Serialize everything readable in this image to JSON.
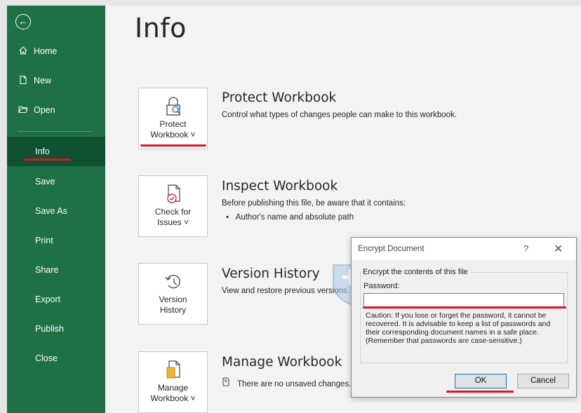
{
  "sidebar": {
    "back_icon": "back-arrow-circle-icon",
    "items": [
      {
        "label": "Home",
        "icon": "home-icon"
      },
      {
        "label": "New",
        "icon": "new-file-icon"
      },
      {
        "label": "Open",
        "icon": "folder-open-icon"
      },
      {
        "label": "Info",
        "selected": true
      },
      {
        "label": "Save"
      },
      {
        "label": "Save As"
      },
      {
        "label": "Print"
      },
      {
        "label": "Share"
      },
      {
        "label": "Export"
      },
      {
        "label": "Publish"
      },
      {
        "label": "Close"
      }
    ],
    "color": "#1e7145",
    "selected_color": "#0f5132"
  },
  "main": {
    "title": "Info",
    "sections": [
      {
        "button_line1": "Protect",
        "button_line2": "Workbook ˅",
        "icon": "lock-magnifier-icon",
        "title": "Protect Workbook",
        "description": "Control what types of changes people can make to this workbook."
      },
      {
        "button_line1": "Check for",
        "button_line2": "Issues ˅",
        "icon": "document-check-icon",
        "title": "Inspect Workbook",
        "description": "Before publishing this file, be aware that it contains:",
        "bullets": [
          "Author's name and absolute path"
        ]
      },
      {
        "button_line1": "Version",
        "button_line2": "History",
        "icon": "history-clock-icon",
        "title": "Version History",
        "description": "View and restore previous versions."
      },
      {
        "button_line1": "Manage",
        "button_line2": "Workbook ˅",
        "icon": "manage-workbook-icon",
        "title": "Manage Workbook",
        "description": "There are no unsaved changes."
      }
    ]
  },
  "dialog": {
    "title": "Encrypt Document",
    "help": "?",
    "close": "✕",
    "group_label": "Encrypt the contents of this file",
    "password_label": "Password:",
    "password_value": "",
    "caution": "Caution: If you lose or forget the password, it cannot be recovered. It is advisable to keep a list of passwords and their corresponding document names in a safe place.",
    "caution_note": "(Remember that passwords are case-sensitive.)",
    "ok": "OK",
    "cancel": "Cancel"
  },
  "colors": {
    "annotation_red": "#e0141e",
    "accent_blue": "#0078d7"
  }
}
